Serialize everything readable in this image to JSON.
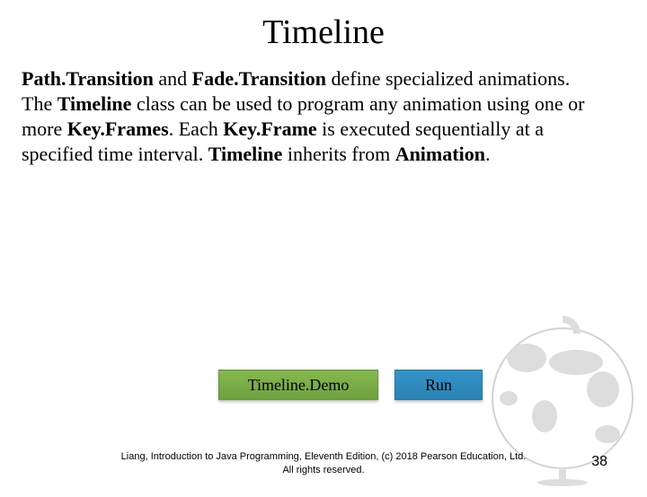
{
  "title": "Timeline",
  "paragraph": {
    "s1a": "Path.Transition",
    "s1b": " and ",
    "s1c": "Fade.Transition",
    "s1d": " define specialized animations. The ",
    "s1e": "Timeline",
    "s1f": " class can be used to program any animation using one or more ",
    "s1g": "Key.Frames",
    "s1h": ". Each ",
    "s1i": "Key.Frame",
    "s1j": " is executed sequentially at a specified time interval. ",
    "s1k": "Timeline",
    "s1l": " inherits from ",
    "s1m": "Animation",
    "s1n": "."
  },
  "buttons": {
    "demo": "Timeline.Demo",
    "run": "Run"
  },
  "footer": {
    "line1": "Liang, Introduction to Java Programming, Eleventh Edition, (c) 2018 Pearson Education, Ltd.",
    "line2": "All rights reserved."
  },
  "page_number": "38"
}
